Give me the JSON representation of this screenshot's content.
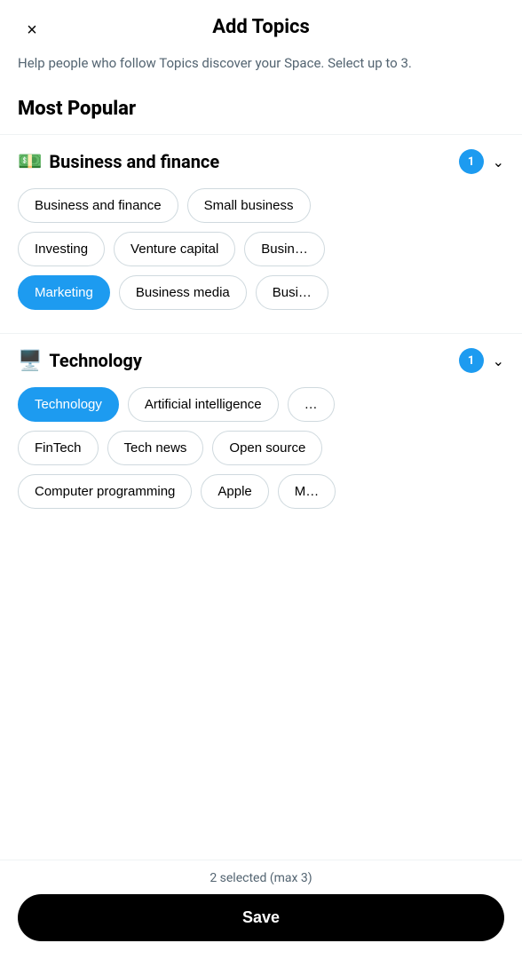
{
  "header": {
    "title": "Add Topics",
    "close_label": "×"
  },
  "subtitle": "Help people who follow Topics discover your Space. Select up to 3.",
  "most_popular_label": "Most Popular",
  "categories": [
    {
      "id": "business",
      "emoji": "💵",
      "name": "Business and finance",
      "count": 1,
      "rows": [
        [
          {
            "label": "Business and finance",
            "selected": false
          },
          {
            "label": "Small business",
            "selected": false
          }
        ],
        [
          {
            "label": "Investing",
            "selected": false
          },
          {
            "label": "Venture capital",
            "selected": false
          },
          {
            "label": "Busin…",
            "selected": false,
            "partial": true
          }
        ],
        [
          {
            "label": "Marketing",
            "selected": true
          },
          {
            "label": "Business media",
            "selected": false
          },
          {
            "label": "Busi…",
            "selected": false,
            "partial": true
          }
        ]
      ]
    },
    {
      "id": "technology",
      "emoji": "🖥️",
      "name": "Technology",
      "count": 1,
      "rows": [
        [
          {
            "label": "Technology",
            "selected": true
          },
          {
            "label": "Artificial intelligence",
            "selected": false
          },
          {
            "label": "…",
            "selected": false,
            "partial": true
          }
        ],
        [
          {
            "label": "FinTech",
            "selected": false
          },
          {
            "label": "Tech news",
            "selected": false
          },
          {
            "label": "Open source",
            "selected": false,
            "partial": true
          }
        ],
        [
          {
            "label": "Computer programming",
            "selected": false
          },
          {
            "label": "Apple",
            "selected": false
          },
          {
            "label": "M…",
            "selected": false,
            "partial": true
          }
        ]
      ]
    }
  ],
  "footer": {
    "selected_text": "2 selected (max 3)",
    "save_label": "Save"
  }
}
